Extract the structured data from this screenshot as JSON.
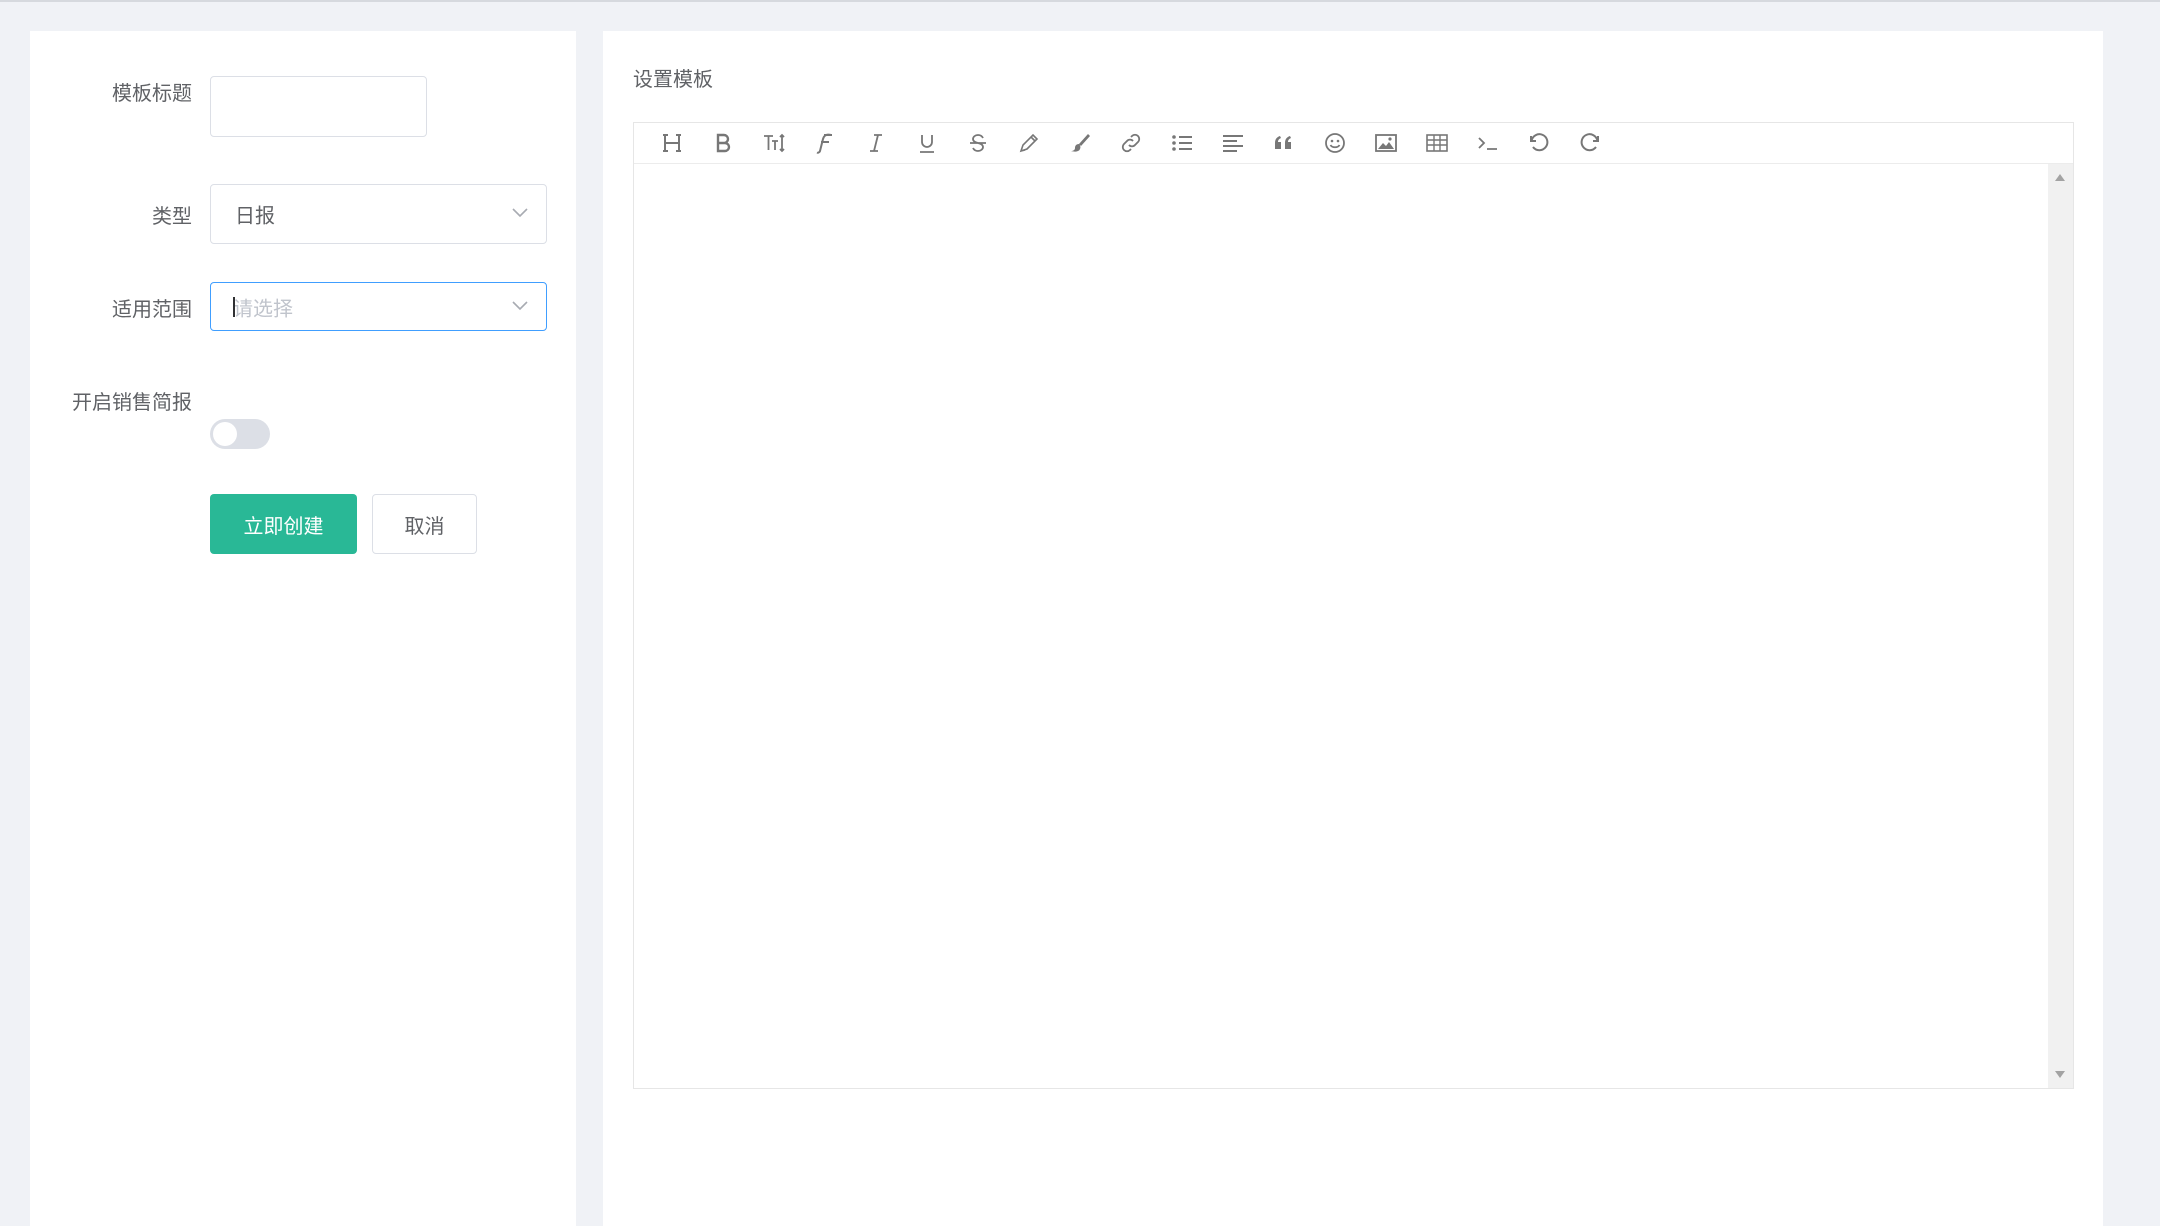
{
  "form": {
    "title_label": "模板标题",
    "title_value": "",
    "type_label": "类型",
    "type_value": "日报",
    "scope_label": "适用范围",
    "scope_placeholder": "请选择",
    "sales_report_label": "开启销售简报",
    "sales_report_enabled": false,
    "create_button": "立即创建",
    "cancel_button": "取消"
  },
  "editor": {
    "section_title": "设置模板",
    "toolbar_icons": [
      "heading-icon",
      "bold-icon",
      "font-size-icon",
      "font-family-icon",
      "italic-icon",
      "underline-icon",
      "strikethrough-icon",
      "fore-color-icon",
      "back-color-icon",
      "link-icon",
      "list-icon",
      "align-icon",
      "quote-icon",
      "emoticon-icon",
      "image-icon",
      "table-icon",
      "code-icon",
      "undo-icon",
      "redo-icon"
    ],
    "content": ""
  },
  "colors": {
    "primary": "#29b896",
    "focus_border": "#409eff",
    "background": "#f0f2f6"
  }
}
